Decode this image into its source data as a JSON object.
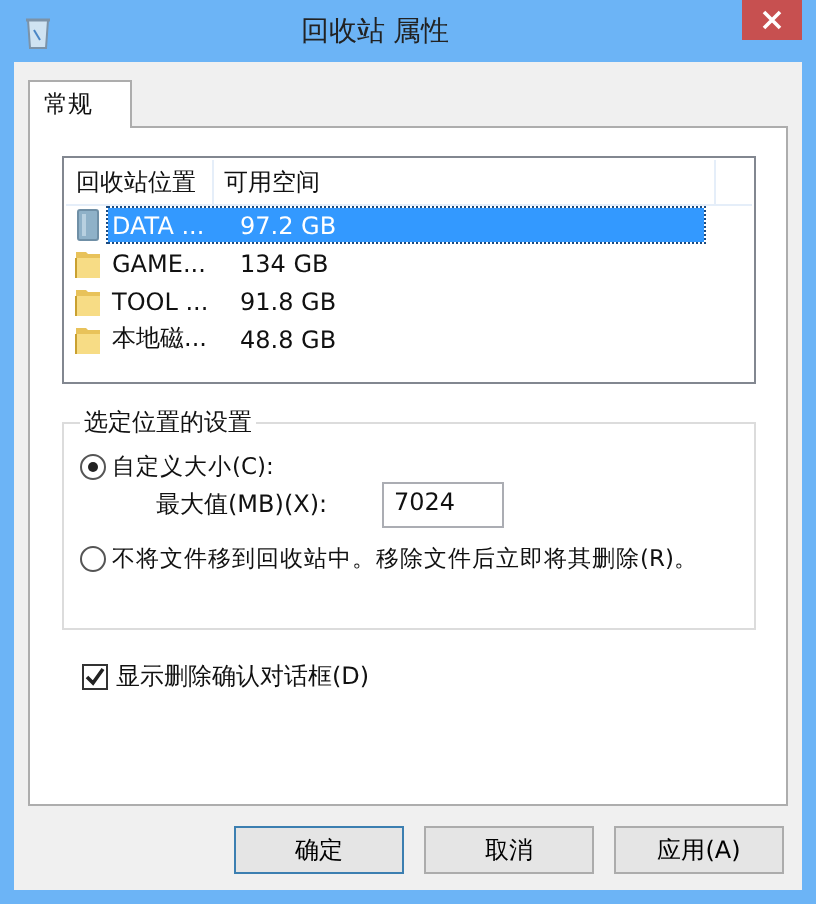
{
  "window": {
    "title": "回收站 属性"
  },
  "tabs": [
    {
      "label": "常规",
      "selected": true
    }
  ],
  "locations": {
    "columns": [
      "回收站位置",
      "可用空间"
    ],
    "rows": [
      {
        "kind": "drive",
        "name": "DATA ...",
        "space": "97.2 GB",
        "selected": true
      },
      {
        "kind": "folder",
        "name": "GAME...",
        "space": "134 GB",
        "selected": false
      },
      {
        "kind": "folder",
        "name": "TOOL ...",
        "space": "91.8 GB",
        "selected": false
      },
      {
        "kind": "folder",
        "name": "本地磁...",
        "space": "48.8 GB",
        "selected": false
      }
    ]
  },
  "settings": {
    "title": "选定位置的设置",
    "custom_size": {
      "label": "自定义大小(C):",
      "selected": true
    },
    "max_label": "最大值(MB)(X):",
    "max_value": "7024",
    "delete_now": {
      "label": "不将文件移到回收站中。移除文件后立即将其删除(R)。",
      "selected": false
    }
  },
  "confirm": {
    "label": "显示删除确认对话框(D)",
    "checked": true
  },
  "buttons": [
    "确定",
    "取消",
    "应用(A)"
  ]
}
